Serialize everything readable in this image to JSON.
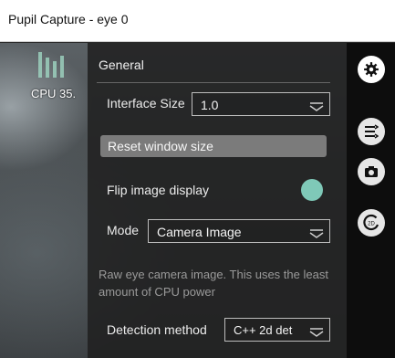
{
  "window": {
    "title": "Pupil Capture - eye 0"
  },
  "overlay": {
    "cpu_label": "CPU 35."
  },
  "menu": {
    "title": "General",
    "interface_size": {
      "label": "Interface Size",
      "value": "1.0"
    },
    "reset_button": "Reset window size",
    "flip_image": {
      "label": "Flip image display",
      "checked": true
    },
    "mode": {
      "label": "Mode",
      "value": "Camera Image"
    },
    "info_text": "Raw eye camera image. This uses the least amount of CPU power",
    "detection_method": {
      "label": "Detection method",
      "value": "C++ 2d det"
    }
  },
  "sidebar": {
    "icons": [
      "gear-icon",
      "list-settings-icon",
      "camera-icon",
      "detector-2d-icon"
    ]
  },
  "colors": {
    "accent": "#7fc9b8",
    "menu_bg": "#202020",
    "sidebar_bg": "#0d0d0d"
  }
}
